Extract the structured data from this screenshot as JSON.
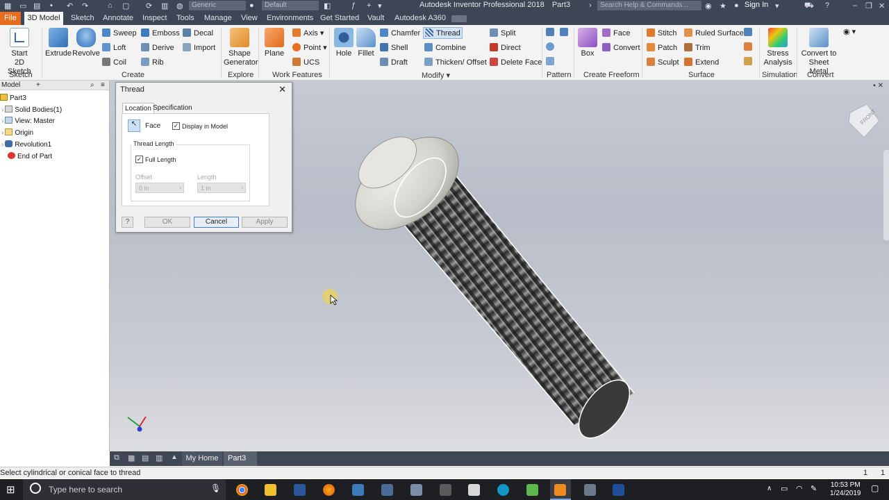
{
  "title_bar": {
    "app_title": "Autodesk Inventor Professional 2018",
    "doc_name": "Part3",
    "material": "Generic",
    "appearance": "Default",
    "search_placeholder": "Search Help & Commands...",
    "sign_in": "Sign In"
  },
  "tabs": [
    "File",
    "3D Model",
    "Sketch",
    "Annotate",
    "Inspect",
    "Tools",
    "Manage",
    "View",
    "Environments",
    "Get Started",
    "Vault",
    "Autodesk A360"
  ],
  "ribbon": {
    "sketch": {
      "start_sketch_1": "Start",
      "start_sketch_2": "2D Sketch",
      "group": "Sketch"
    },
    "create": {
      "extrude": "Extrude",
      "revolve": "Revolve",
      "sweep": "Sweep",
      "loft": "Loft",
      "coil": "Coil",
      "emboss": "Emboss",
      "derive": "Derive",
      "rib": "Rib",
      "decal": "Decal",
      "import": "Import",
      "group": "Create"
    },
    "explore": {
      "shape_1": "Shape",
      "shape_2": "Generator",
      "group": "Explore"
    },
    "work_features": {
      "plane": "Plane",
      "axis": "Axis",
      "point": "Point",
      "ucs": "UCS",
      "group": "Work Features"
    },
    "modify": {
      "hole": "Hole",
      "fillet": "Fillet",
      "chamfer": "Chamfer",
      "shell": "Shell",
      "draft": "Draft",
      "thread": "Thread",
      "combine": "Combine",
      "thicken": "Thicken/ Offset",
      "split": "Split",
      "direct": "Direct",
      "delete_face": "Delete Face",
      "group": "Modify"
    },
    "pattern": {
      "group": "Pattern"
    },
    "freeform": {
      "box": "Box",
      "face": "Face",
      "convert": "Convert",
      "group": "Create Freeform"
    },
    "surface": {
      "stitch": "Stitch",
      "patch": "Patch",
      "sculpt": "Sculpt",
      "ruled": "Ruled Surface",
      "trim": "Trim",
      "extend": "Extend",
      "group": "Surface"
    },
    "simulation": {
      "stress_1": "Stress",
      "stress_2": "Analysis",
      "group": "Simulation"
    },
    "convert": {
      "sheet_1": "Convert to",
      "sheet_2": "Sheet Metal",
      "group": "Convert"
    }
  },
  "browser": {
    "tab": "Model",
    "items": [
      "Part3",
      "Solid Bodies(1)",
      "View: Master",
      "Origin",
      "Revolution1",
      "End of Part"
    ]
  },
  "dialog": {
    "title": "Thread",
    "tab_location": "Location",
    "tab_specification": "Specification",
    "face_label": "Face",
    "display_in_model": "Display in Model",
    "display_checked": true,
    "thread_length": "Thread Length",
    "full_length": "Full Length",
    "full_checked": true,
    "offset_label": "Offset",
    "offset_value": "0 in",
    "length_label": "Length",
    "length_value": "1 in",
    "ok": "OK",
    "cancel": "Cancel",
    "apply": "Apply",
    "help": "?"
  },
  "viewcube_label": "FRONT",
  "doc_tabs": {
    "home": "My Home",
    "part": "Part3"
  },
  "status": {
    "message": "Select cylindrical or conical face to thread",
    "right_1": "1",
    "right_2": "1"
  },
  "taskbar": {
    "search_placeholder": "Type here to search",
    "time": "10:53 PM",
    "date": "1/24/2019"
  }
}
